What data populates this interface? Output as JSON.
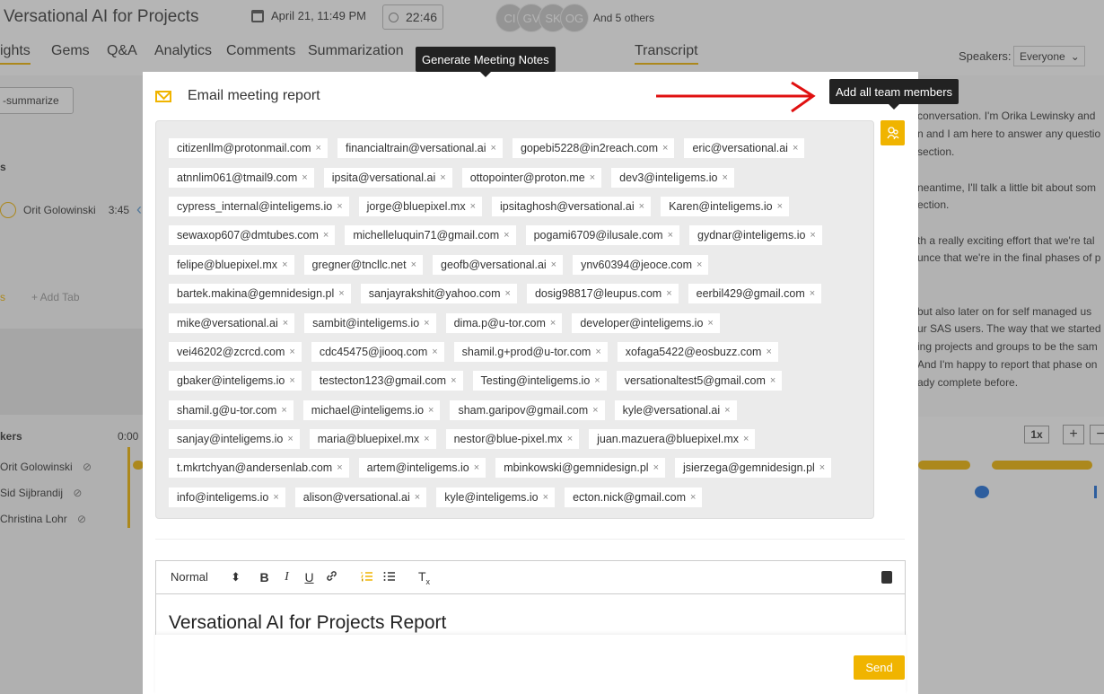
{
  "header": {
    "app_title": "Versational AI for Projects",
    "date": "April 21, 11:49 PM",
    "duration": "22:46",
    "avatars": [
      "CI",
      "GV",
      "SK",
      "OG"
    ],
    "others": "And 5 others"
  },
  "tabs": [
    "ights",
    "Gems",
    "Q&A",
    "Analytics",
    "Comments",
    "Summarization",
    "Transcript"
  ],
  "speakers": {
    "label": "Speakers:",
    "value": "Everyone"
  },
  "left_panel": {
    "resummarize": "-summarize",
    "section_letter": "s",
    "speaker_entry": "Orit Golowinski",
    "speaker_time": "3:45",
    "tab_fragment": "s",
    "add_tab": "+ Add Tab",
    "speakers_heading": "kers",
    "time_start": "0:00",
    "speaker_rows": [
      "Orit Golowinski",
      "Sid Sijbrandij",
      "Christina Lohr"
    ]
  },
  "transcript_lines": [
    "conversation. I'm Orika Lewinsky and",
    "n and I am here to answer any questio",
    "section.",
    "neantime, I'll talk a little bit about som",
    "ection.",
    "th a really exciting effort that we're tal",
    "unce that we're in the final phases of p",
    "but also later on for self managed us",
    "ur SAS users. The way that we started",
    "ing projects and groups to be the sam",
    "And I'm happy to report that phase on",
    "ady complete before."
  ],
  "playback": {
    "speed": "1x",
    "zoom_in": "+",
    "zoom_out": "−"
  },
  "modal": {
    "title": "Email meeting report",
    "recipients": [
      [
        "citizenllm@protonmail.com",
        "financialtrain@versational.ai",
        "gopebi5228@in2reach.com",
        "eric@versational.ai"
      ],
      [
        "atnnlim061@tmail9.com",
        "ipsita@versational.ai",
        "ottopointer@proton.me",
        "dev3@inteligems.io"
      ],
      [
        "cypress_internal@inteligems.io",
        "jorge@bluepixel.mx",
        "ipsitaghosh@versational.ai",
        "Karen@inteligems.io"
      ],
      [
        "sewaxop607@dmtubes.com",
        "michelleluquin71@gmail.com",
        "pogami6709@ilusale.com",
        "gydnar@inteligems.io"
      ],
      [
        "felipe@bluepixel.mx",
        "gregner@tncllc.net",
        "geofb@versational.ai",
        "ynv60394@jeoce.com"
      ],
      [
        "bartek.makina@gemnidesign.pl",
        "sanjayrakshit@yahoo.com",
        "dosig98817@leupus.com",
        "eerbil429@gmail.com"
      ],
      [
        "mike@versational.ai",
        "sambit@inteligems.io",
        "dima.p@u-tor.com",
        "developer@inteligems.io"
      ],
      [
        "vei46202@zcrcd.com",
        "cdc45475@jiooq.com",
        "shamil.g+prod@u-tor.com",
        "xofaga5422@eosbuzz.com"
      ],
      [
        "gbaker@inteligems.io",
        "testecton123@gmail.com",
        "Testing@inteligems.io",
        "versationaltest5@gmail.com"
      ],
      [
        "shamil.g@u-tor.com",
        "michael@inteligems.io",
        "sham.garipov@gmail.com",
        "kyle@versational.ai"
      ],
      [
        "sanjay@inteligems.io",
        "maria@bluepixel.mx",
        "nestor@blue-pixel.mx",
        "juan.mazuera@bluepixel.mx"
      ],
      [
        "t.mkrtchyan@andersenlab.com",
        "artem@inteligems.io",
        "mbinkowski@gemnidesign.pl",
        "jsierzega@gemnidesign.pl"
      ],
      [
        "info@inteligems.io",
        "alison@versational.ai",
        "kyle@inteligems.io",
        "ecton.nick@gmail.com"
      ]
    ],
    "chip_remove": "×",
    "editor": {
      "format": "Normal",
      "format_arrow": "⬍",
      "content_title": "Versational AI for Projects Report"
    },
    "send_label": "Send"
  },
  "tooltips": {
    "generate_notes": "Generate Meeting Notes",
    "add_team": "Add all team members"
  },
  "colors": {
    "accent": "#f0b400",
    "arrow": "#e01010"
  }
}
